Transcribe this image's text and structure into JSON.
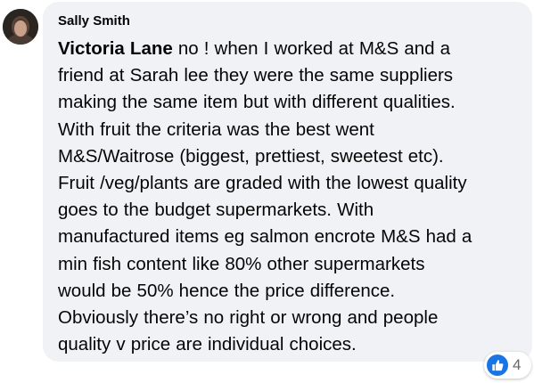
{
  "comment": {
    "author": "Sally Smith",
    "mention": "Victoria Lane",
    "text_lines": [
      " no ! when I worked at M&S and a",
      "friend at Sarah lee they were the same suppliers",
      "making the same item but with different qualities.",
      "With fruit the criteria was the best went",
      "M&S/Waitrose (biggest, prettiest, sweetest etc).",
      "Fruit /veg/plants are graded with the lowest quality",
      "goes to the budget supermarkets. With",
      "manufactured items eg salmon encrote M&S had a",
      "min fish content like 80% other supermarkets",
      "would be 50% hence the price difference.",
      "Obviously there’s no right or wrong and people",
      "quality v price are individual choices."
    ]
  },
  "reactions": {
    "icon": "like-icon",
    "count": "4"
  },
  "colors": {
    "bubble_bg": "#f0f2f5",
    "text": "#050505",
    "like_blue": "#1b74e4",
    "count_gray": "#65676b"
  }
}
